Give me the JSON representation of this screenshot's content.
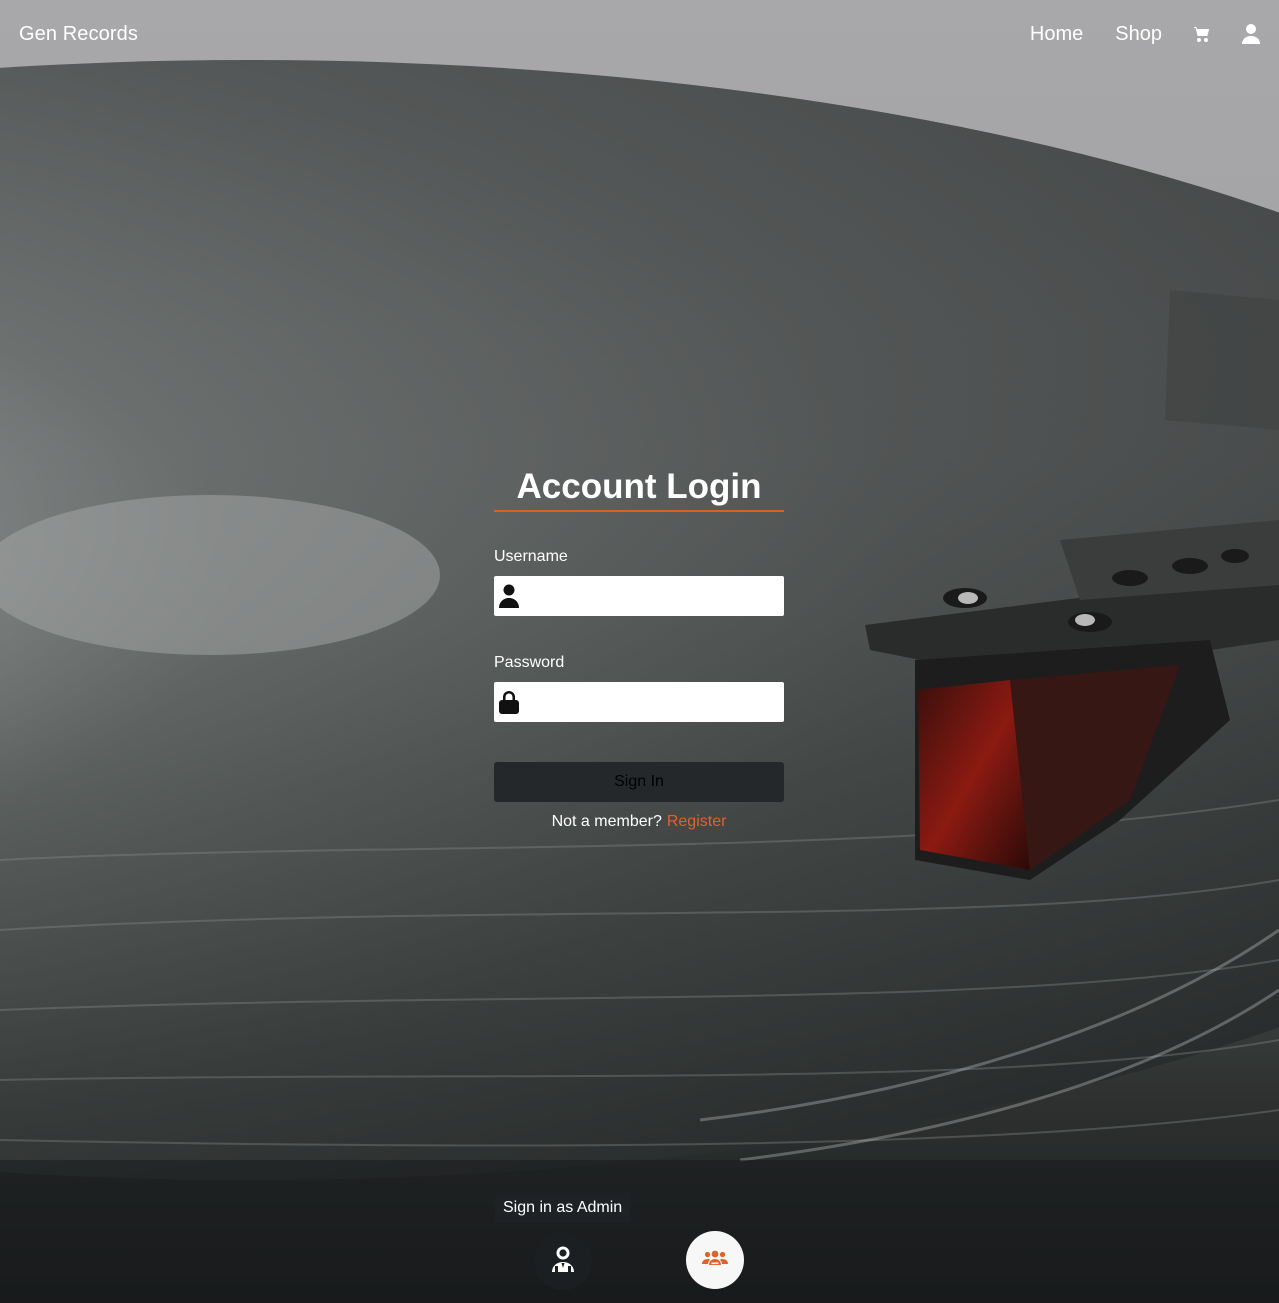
{
  "navbar": {
    "brand": "Gen Records",
    "links": [
      {
        "label": "Home"
      },
      {
        "label": "Shop"
      }
    ],
    "icons": [
      "cart-icon",
      "user-icon"
    ]
  },
  "login": {
    "title": "Account Login",
    "username": {
      "label": "Username",
      "value": "",
      "placeholder": ""
    },
    "password": {
      "label": "Password",
      "value": "",
      "placeholder": ""
    },
    "submit_label": "Sign In",
    "not_member_text": "Not a member?",
    "register_label": "Register"
  },
  "quick_login": {
    "tooltip": "Sign in as Admin",
    "admin_icon": "admin-icon",
    "user_icon": "users-group-icon"
  },
  "colors": {
    "accent": "#e0622b",
    "button_dark": "#25282b"
  }
}
